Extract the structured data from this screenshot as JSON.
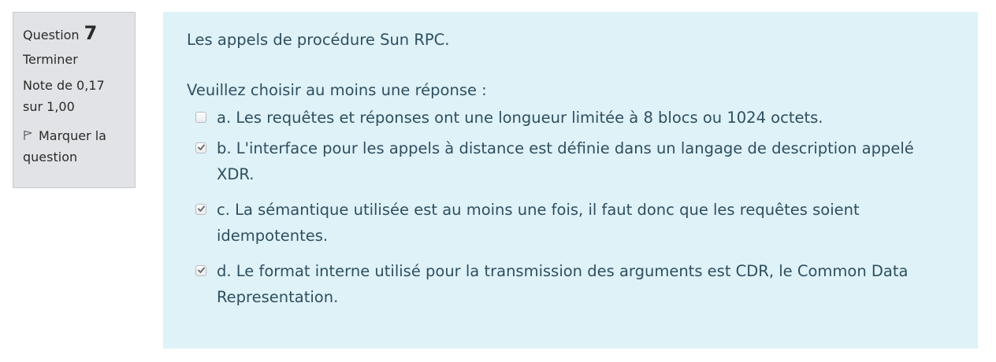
{
  "info": {
    "question_label": "Question",
    "question_number": "7",
    "state": "Terminer",
    "grade": "Note de 0,17 sur 1,00",
    "flag_label": "Marquer la question"
  },
  "question": {
    "text": "Les appels de procédure Sun RPC.",
    "prompt": "Veuillez choisir au moins une réponse :",
    "options": [
      {
        "label": "a. Les requêtes et réponses ont une longueur limitée à 8 blocs ou 1024 octets.",
        "checked": false
      },
      {
        "label": "b. L'interface pour les appels à distance est définie dans un langage de description appelé XDR.",
        "checked": true
      },
      {
        "label": "c. La sémantique utilisée est au moins une fois, il faut donc que les requêtes soient idempotentes.",
        "checked": true
      },
      {
        "label": "d. Le format interne utilisé pour la transmission des arguments est CDR, le Common Data Representation.",
        "checked": true
      }
    ]
  },
  "colors": {
    "content_bg": "#def2f8",
    "info_bg": "#e1e3e6",
    "text": "#2f4f5f"
  }
}
